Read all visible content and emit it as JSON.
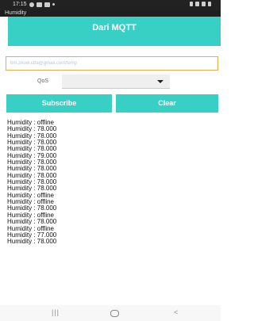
{
  "status_bar": {
    "time": "17:15"
  },
  "app": {
    "title": "Humidity"
  },
  "header": {
    "title": "Dari MQTT"
  },
  "topic_input": {
    "value": "bm.zeuel.iafa@gmail.com/temp"
  },
  "qos": {
    "label": "QoS",
    "selected": ""
  },
  "buttons": {
    "subscribe": "Subscribe",
    "clear": "Clear"
  },
  "messages": [
    "Humidity : offline",
    "Humidity : 78.000",
    "Humidity : 78.000",
    "Humidity : 78.000",
    "Humidity : 78.000",
    "Humidity : 79.000",
    "Humidity : 78.000",
    "Humidity : 78.000",
    "Humidity : 78.000",
    "Humidity : 78.000",
    "Humidity : 78.000",
    "Humidity : offline",
    "Humidity : offline",
    "Humidity : 78.000",
    "Humidity : offline",
    "Humidity : 78.000",
    "Humidity : offline",
    "Humidity : 77.000",
    "Humidity : 78.000"
  ],
  "nav": {
    "recents": "|||",
    "back": "<"
  },
  "colors": {
    "accent": "#38cfc4",
    "input_border": "#f0a94a",
    "status_bar": "#222222"
  }
}
